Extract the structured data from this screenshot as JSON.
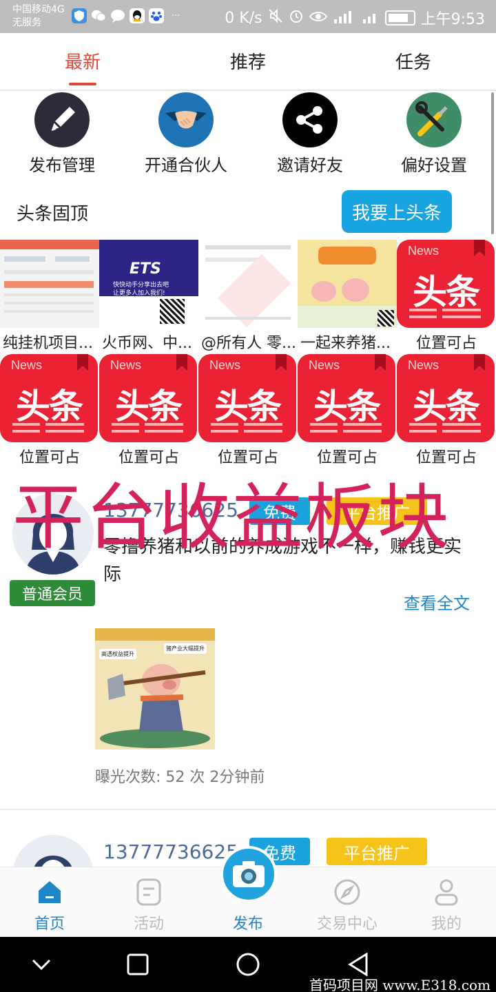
{
  "status_bar": {
    "carrier_line1": "中国移动4G",
    "carrier_line2": "无服务",
    "speed": "0 K/s",
    "time": "上午9:53",
    "apps": [
      "shield-app-icon",
      "wechat-icon",
      "message-icon",
      "qq-icon",
      "baidu-icon"
    ],
    "more": "···"
  },
  "tabs": [
    "最新",
    "推荐",
    "任务"
  ],
  "quick_actions": [
    {
      "label": "发布管理",
      "icon": "pen-icon",
      "color": "#2b2b3a"
    },
    {
      "label": "开通合伙人",
      "icon": "handshake-icon",
      "color": "#1f74b6"
    },
    {
      "label": "邀请好友",
      "icon": "share-icon",
      "color": "#000000"
    },
    {
      "label": "偏好设置",
      "icon": "tools-icon",
      "color": "#3e8d67"
    }
  ],
  "headline": {
    "title": "头条固顶",
    "button": "我要上头条"
  },
  "tiles_row1": [
    {
      "caption": "纯挂机项目...",
      "type": "screenshot"
    },
    {
      "caption": "火币网、中...",
      "type": "ets"
    },
    {
      "caption": "@所有人 零...",
      "type": "chat"
    },
    {
      "caption": "一起来养猪...",
      "type": "pig"
    },
    {
      "caption": "位置可占",
      "type": "news"
    }
  ],
  "tiles_row2": [
    {
      "caption": "位置可占"
    },
    {
      "caption": "位置可占"
    },
    {
      "caption": "位置可占"
    },
    {
      "caption": "位置可占"
    },
    {
      "caption": "位置可占"
    }
  ],
  "news_tile": {
    "tag": "News",
    "text": "头条"
  },
  "ets_tile": {
    "logo": "ETS",
    "line1": "快快动手分享出去吧",
    "line2": "让更多人加入我们!"
  },
  "overlay_text": "平台收益板块",
  "post": {
    "phone": "13777736625",
    "tag_free": "免费",
    "tag_platform": "平台推广",
    "member": "普通会员",
    "text": "零撸养猪和以前的养成游戏不一样，赚钱更实际",
    "read_more": "查看全文",
    "image_label_left": "高透权益提升",
    "image_label_right": "猪产业大幅提升",
    "meta": "曝光次数: 52 次  2分钟前"
  },
  "post2": {
    "phone": "13777736625",
    "tag_free": "免费",
    "tag_platform": "平台推广"
  },
  "bottom_nav": [
    {
      "label": "首页",
      "icon": "home-icon"
    },
    {
      "label": "活动",
      "icon": "activity-icon"
    },
    {
      "label": "发布",
      "icon": "camera-icon"
    },
    {
      "label": "交易中心",
      "icon": "compass-icon"
    },
    {
      "label": "我的",
      "icon": "profile-icon"
    }
  ],
  "site_watermark": "首码项目网 www.E318.com",
  "colors": {
    "accent": "#e0473a",
    "blue": "#1e86c8",
    "news_red": "#ea2233",
    "overlay": "#d4235a"
  }
}
